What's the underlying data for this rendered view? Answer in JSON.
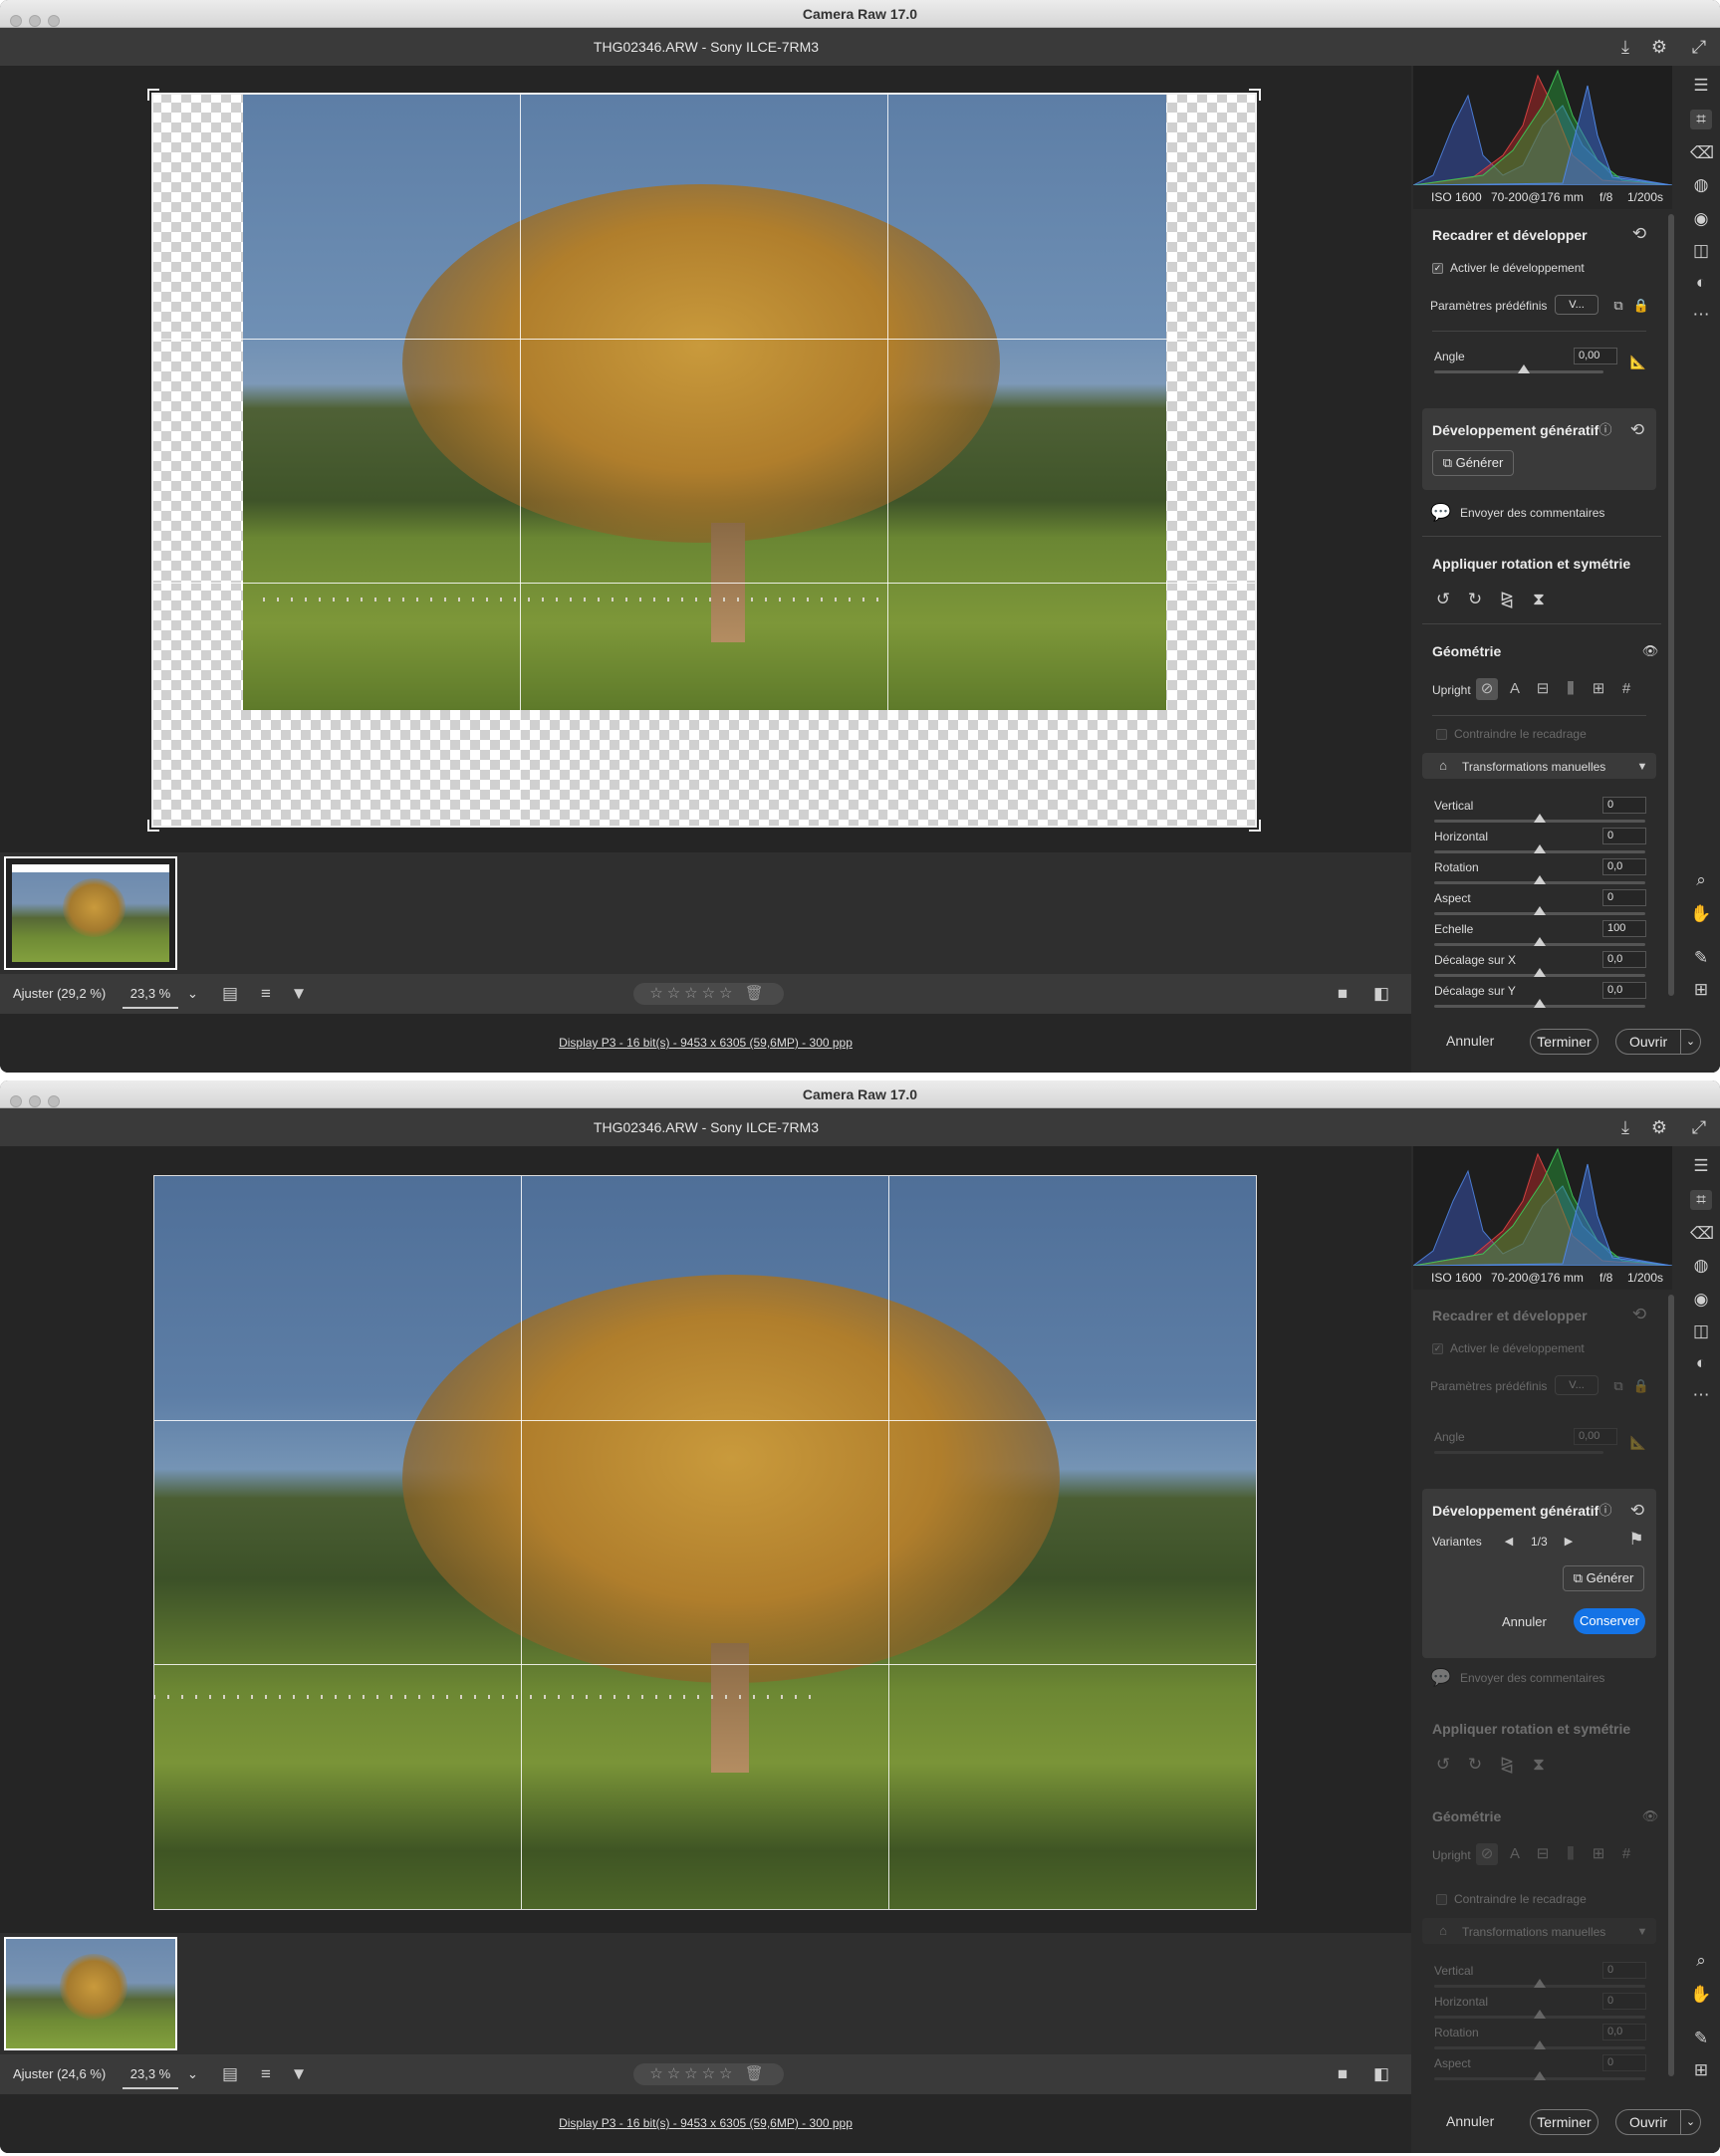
{
  "app_title": "Camera Raw 17.0",
  "file_title": "THG02346.ARW  -  Sony ILCE-7RM3",
  "exif": {
    "iso": "ISO 1600",
    "lens": "70-200@176 mm",
    "aperture": "f/8",
    "shutter": "1/200s"
  },
  "status_link": "Display P3 - 16 bit(s) - 9453 x 6305 (59,6MP) - 300 ppp",
  "zoom_value": "23,3 %",
  "zoom_chevron": "⌄",
  "rating_stars": "☆☆☆☆☆",
  "trash_icon": "🗑",
  "footer": {
    "cancel": "Annuler",
    "done": "Terminer",
    "open": "Ouvrir"
  },
  "crop": {
    "title": "Recadrer et développer",
    "enable_expand": "Activer le développement",
    "presets_label": "Paramètres prédéfinis",
    "presets_value": "V...",
    "angle_label": "Angle",
    "angle_value": "0,00"
  },
  "generative": {
    "title": "Développement génératif",
    "generate": "Générer",
    "variants_label": "Variantes",
    "variants_counter": "1/3",
    "cancel": "Annuler",
    "keep": "Conserver"
  },
  "feedback": "Envoyer des commentaires",
  "rotate_section": "Appliquer rotation et symétrie",
  "geometry": {
    "title": "Géométrie",
    "upright": "Upright",
    "constrain_crop": "Contraindre le recadrage",
    "manual_transforms": "Transformations manuelles",
    "sliders": [
      {
        "label": "Vertical",
        "value": "0",
        "position": 0.5
      },
      {
        "label": "Horizontal",
        "value": "0",
        "position": 0.5
      },
      {
        "label": "Rotation",
        "value": "0,0",
        "position": 0.5
      },
      {
        "label": "Aspect",
        "value": "0",
        "position": 0.5
      },
      {
        "label": "Echelle",
        "value": "100",
        "position": 0.5
      },
      {
        "label": "Décalage sur X",
        "value": "0,0",
        "position": 0.5
      },
      {
        "label": "Décalage sur Y",
        "value": "0,0",
        "position": 0.5
      }
    ]
  },
  "windows": [
    {
      "fit_label": "Ajuster (29,2 %)"
    },
    {
      "fit_label": "Ajuster (24,6 %)"
    }
  ]
}
